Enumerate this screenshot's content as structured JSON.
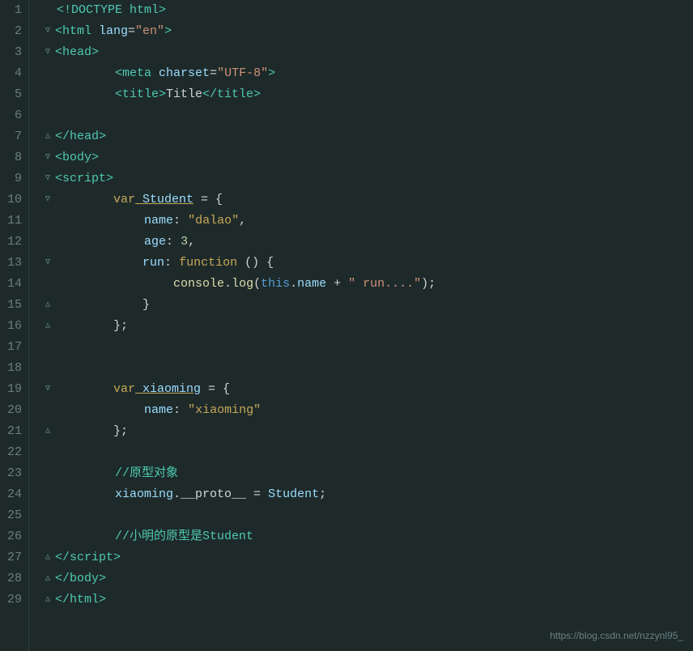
{
  "lines": [
    {
      "num": 1,
      "fold": "none",
      "content": "html_doctype"
    },
    {
      "num": 2,
      "fold": "open",
      "content": "html_open"
    },
    {
      "num": 3,
      "fold": "open",
      "content": "head_open"
    },
    {
      "num": 4,
      "fold": "none",
      "content": "meta"
    },
    {
      "num": 5,
      "fold": "none",
      "content": "title"
    },
    {
      "num": 6,
      "fold": "none",
      "content": "empty"
    },
    {
      "num": 7,
      "fold": "close",
      "content": "head_close"
    },
    {
      "num": 8,
      "fold": "open",
      "content": "body_open"
    },
    {
      "num": 9,
      "fold": "open",
      "content": "script_open"
    },
    {
      "num": 10,
      "fold": "open",
      "content": "var_student"
    },
    {
      "num": 11,
      "fold": "none",
      "content": "name_prop"
    },
    {
      "num": 12,
      "fold": "none",
      "content": "age_prop"
    },
    {
      "num": 13,
      "fold": "open",
      "content": "run_prop"
    },
    {
      "num": 14,
      "fold": "none",
      "content": "console_log"
    },
    {
      "num": 15,
      "fold": "close",
      "content": "close_brace"
    },
    {
      "num": 16,
      "fold": "close",
      "content": "close_obj"
    },
    {
      "num": 17,
      "fold": "none",
      "content": "empty"
    },
    {
      "num": 18,
      "fold": "none",
      "content": "empty"
    },
    {
      "num": 19,
      "fold": "open",
      "content": "var_xiaoming"
    },
    {
      "num": 20,
      "fold": "none",
      "content": "name_prop2"
    },
    {
      "num": 21,
      "fold": "close",
      "content": "close_obj2"
    },
    {
      "num": 22,
      "fold": "none",
      "content": "empty"
    },
    {
      "num": 23,
      "fold": "none",
      "content": "comment1"
    },
    {
      "num": 24,
      "fold": "none",
      "content": "proto_assign"
    },
    {
      "num": 25,
      "fold": "none",
      "content": "empty"
    },
    {
      "num": 26,
      "fold": "none",
      "content": "comment2"
    },
    {
      "num": 27,
      "fold": "close",
      "content": "script_close"
    },
    {
      "num": 28,
      "fold": "close",
      "content": "body_close"
    },
    {
      "num": 29,
      "fold": "close",
      "content": "html_close"
    }
  ],
  "watermark": "https://blog.csdn.net/nzzynl95_"
}
